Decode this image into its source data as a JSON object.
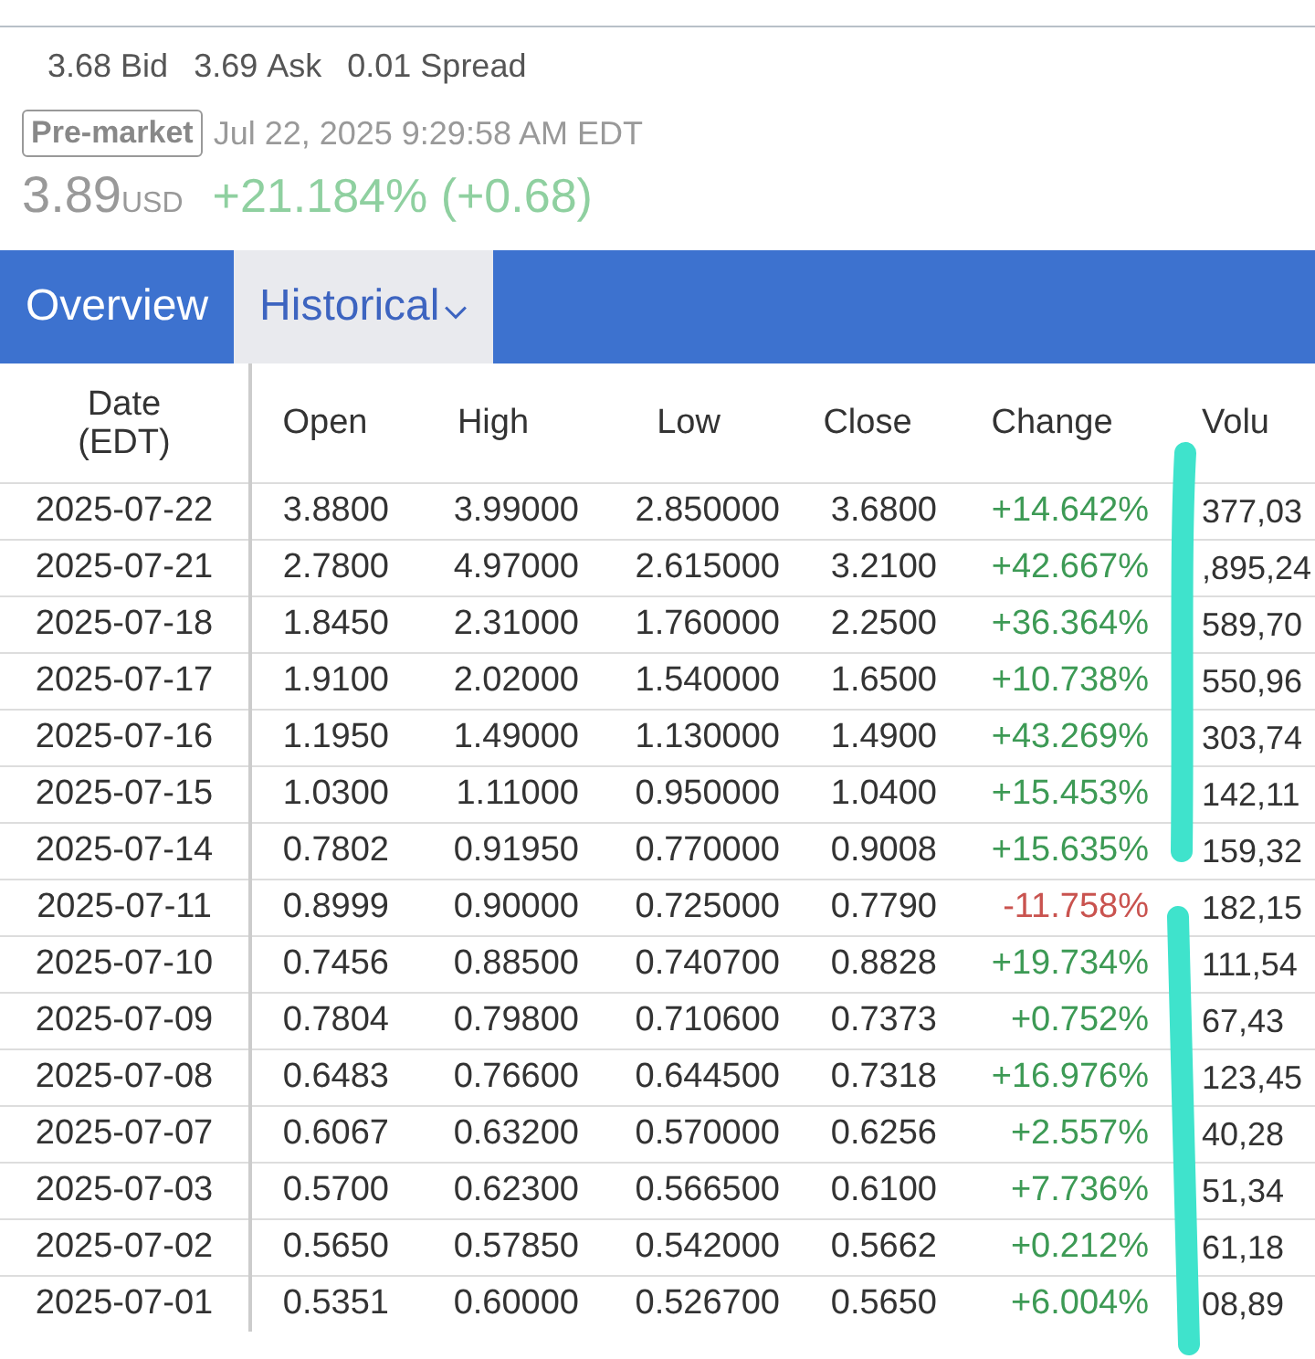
{
  "quote": {
    "bid": "3.68",
    "bid_label": "Bid",
    "ask": "3.69",
    "ask_label": "Ask",
    "spread": "0.01",
    "spread_label": "Spread",
    "session": "Pre-market",
    "timestamp": "Jul 22, 2025 9:29:58 AM EDT",
    "price": "3.89",
    "currency": "USD",
    "change": "+21.184% (+0.68)"
  },
  "tabs": [
    {
      "label": "Overview",
      "selected": false,
      "has_menu": false
    },
    {
      "label": "Historical",
      "selected": true,
      "has_menu": true
    }
  ],
  "table": {
    "columns": [
      "Date\n(EDT)",
      "Open",
      "High",
      "Low",
      "Close",
      "Change",
      "Volu"
    ],
    "rows": [
      {
        "date": "2025-07-22",
        "open": "3.8800",
        "high": "3.99000",
        "low": "2.850000",
        "close": "3.6800",
        "change": "+14.642%",
        "negative": false,
        "volume": "377,03"
      },
      {
        "date": "2025-07-21",
        "open": "2.7800",
        "high": "4.97000",
        "low": "2.615000",
        "close": "3.2100",
        "change": "+42.667%",
        "negative": false,
        "volume": ",895,24"
      },
      {
        "date": "2025-07-18",
        "open": "1.8450",
        "high": "2.31000",
        "low": "1.760000",
        "close": "2.2500",
        "change": "+36.364%",
        "negative": false,
        "volume": "589,70"
      },
      {
        "date": "2025-07-17",
        "open": "1.9100",
        "high": "2.02000",
        "low": "1.540000",
        "close": "1.6500",
        "change": "+10.738%",
        "negative": false,
        "volume": "550,96"
      },
      {
        "date": "2025-07-16",
        "open": "1.1950",
        "high": "1.49000",
        "low": "1.130000",
        "close": "1.4900",
        "change": "+43.269%",
        "negative": false,
        "volume": "303,74"
      },
      {
        "date": "2025-07-15",
        "open": "1.0300",
        "high": "1.11000",
        "low": "0.950000",
        "close": "1.0400",
        "change": "+15.453%",
        "negative": false,
        "volume": "142,11"
      },
      {
        "date": "2025-07-14",
        "open": "0.7802",
        "high": "0.91950",
        "low": "0.770000",
        "close": "0.9008",
        "change": "+15.635%",
        "negative": false,
        "volume": "159,32"
      },
      {
        "date": "2025-07-11",
        "open": "0.8999",
        "high": "0.90000",
        "low": "0.725000",
        "close": "0.7790",
        "change": "-11.758%",
        "negative": true,
        "volume": "182,15"
      },
      {
        "date": "2025-07-10",
        "open": "0.7456",
        "high": "0.88500",
        "low": "0.740700",
        "close": "0.8828",
        "change": "+19.734%",
        "negative": false,
        "volume": "111,54"
      },
      {
        "date": "2025-07-09",
        "open": "0.7804",
        "high": "0.79800",
        "low": "0.710600",
        "close": "0.7373",
        "change": "+0.752%",
        "negative": false,
        "volume": "67,43"
      },
      {
        "date": "2025-07-08",
        "open": "0.6483",
        "high": "0.76600",
        "low": "0.644500",
        "close": "0.7318",
        "change": "+16.976%",
        "negative": false,
        "volume": "123,45"
      },
      {
        "date": "2025-07-07",
        "open": "0.6067",
        "high": "0.63200",
        "low": "0.570000",
        "close": "0.6256",
        "change": "+2.557%",
        "negative": false,
        "volume": "40,28"
      },
      {
        "date": "2025-07-03",
        "open": "0.5700",
        "high": "0.62300",
        "low": "0.566500",
        "close": "0.6100",
        "change": "+7.736%",
        "negative": false,
        "volume": "51,34"
      },
      {
        "date": "2025-07-02",
        "open": "0.5650",
        "high": "0.57850",
        "low": "0.542000",
        "close": "0.5662",
        "change": "+0.212%",
        "negative": false,
        "volume": "61,18"
      },
      {
        "date": "2025-07-01",
        "open": "0.5351",
        "high": "0.60000",
        "low": "0.526700",
        "close": "0.5650",
        "change": "+6.004%",
        "negative": false,
        "volume": "08,89"
      }
    ]
  },
  "annotations": [
    {
      "kind": "stroke"
    },
    {
      "kind": "stroke"
    }
  ]
}
